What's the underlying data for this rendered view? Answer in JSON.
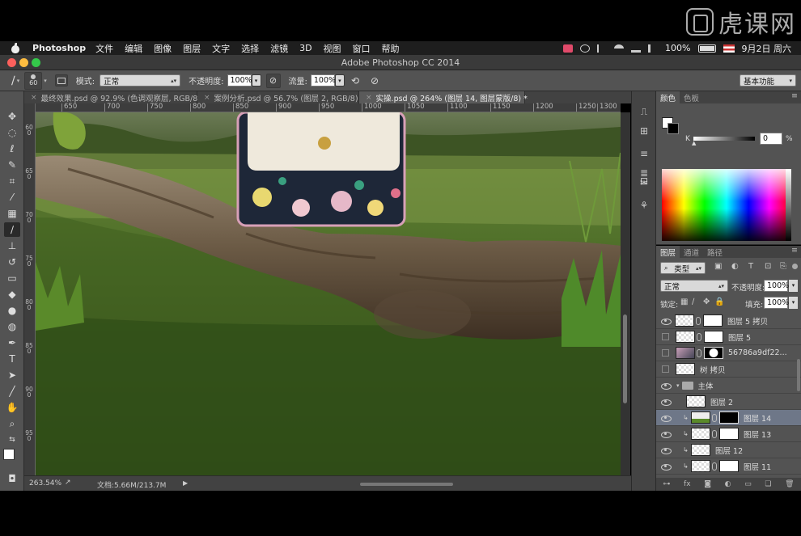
{
  "watermark": {
    "text": "虎课网"
  },
  "menubar": {
    "app_name": "Photoshop",
    "items": [
      "文件",
      "编辑",
      "图像",
      "图层",
      "文字",
      "选择",
      "滤镜",
      "3D",
      "视图",
      "窗口",
      "帮助"
    ],
    "battery": "100%",
    "date": "9月2日 周六"
  },
  "window": {
    "title": "Adobe Photoshop CC 2014"
  },
  "options": {
    "brush_size": "60",
    "mode_label": "模式:",
    "mode_value": "正常",
    "opacity_label": "不透明度:",
    "opacity_value": "100%",
    "flow_label": "流量:",
    "flow_value": "100%",
    "workspace": "基本功能"
  },
  "tabs": [
    {
      "label": "最终效果.psd @ 92.9% (色调观察层, RGB/8) *",
      "active": false
    },
    {
      "label": "案例分析.psd @ 56.7% (图层 2, RGB/8) *",
      "active": false
    },
    {
      "label": "实操.psd @ 264% (图层 14, 图层蒙版/8) *",
      "active": true
    }
  ],
  "ruler": {
    "h": [
      "650",
      "700",
      "750",
      "800",
      "850",
      "900",
      "950",
      "1000",
      "1050",
      "1100",
      "1150",
      "1200",
      "1250",
      "1300"
    ],
    "v": [
      "600",
      "650",
      "700",
      "750",
      "800",
      "850",
      "900",
      "950"
    ]
  },
  "status": {
    "zoom": "263.54%",
    "doc": "文档:5.66M/213.7M"
  },
  "color_panel": {
    "tabs": [
      "颜色",
      "色板"
    ],
    "k_label": "K",
    "k_value": "0",
    "k_unit": "%"
  },
  "layers_panel": {
    "tabs": [
      "图层",
      "通道",
      "路径"
    ],
    "filter_label": "类型",
    "blend_mode": "正常",
    "opacity_label": "不透明度:",
    "opacity_value": "100%",
    "lock_label": "锁定:",
    "fill_label": "填充:",
    "fill_value": "100%",
    "layers": [
      {
        "name": "图层 5 拷贝",
        "visible": true
      },
      {
        "name": "图层 5",
        "visible": false
      },
      {
        "name": "56786a9df22...",
        "visible": false
      },
      {
        "name": "树 拷贝",
        "visible": false
      },
      {
        "name": "主体",
        "visible": true,
        "group": true
      },
      {
        "name": "图层 2",
        "visible": true
      },
      {
        "name": "图层 14",
        "visible": true,
        "selected": true
      },
      {
        "name": "图层 13",
        "visible": true
      },
      {
        "name": "图层 12",
        "visible": true
      },
      {
        "name": "图层 11",
        "visible": true
      }
    ]
  }
}
